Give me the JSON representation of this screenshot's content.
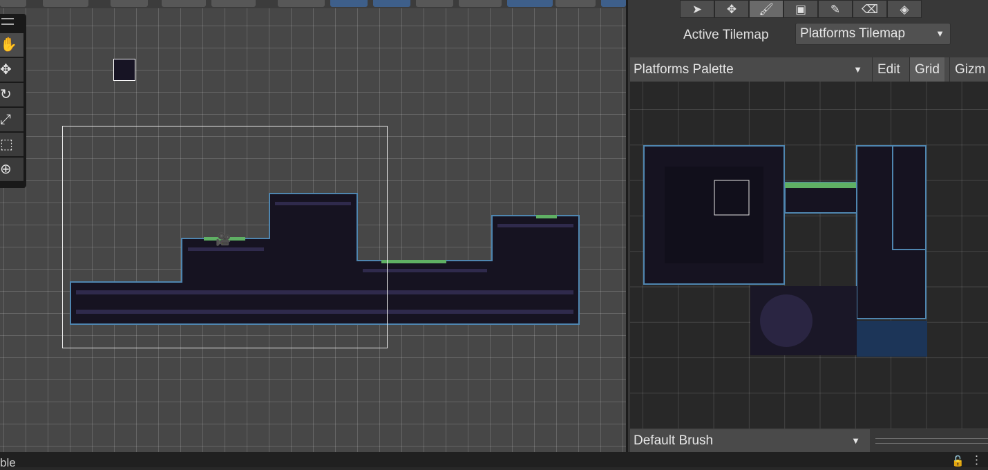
{
  "palette_tools": [
    {
      "name": "select-tool",
      "icon": "arrow-cursor-icon",
      "glyph": "➤"
    },
    {
      "name": "move-tool",
      "icon": "move-arrows-icon",
      "glyph": "✥"
    },
    {
      "name": "paint-tool",
      "icon": "paintbrush-icon",
      "glyph": "🖌"
    },
    {
      "name": "box-fill-tool",
      "icon": "box-fill-icon",
      "glyph": "▣"
    },
    {
      "name": "picker-tool",
      "icon": "eyedropper-icon",
      "glyph": "✎"
    },
    {
      "name": "eraser-tool",
      "icon": "eraser-icon",
      "glyph": "⌫"
    },
    {
      "name": "fill-tool",
      "icon": "paint-bucket-icon",
      "glyph": "◈"
    }
  ],
  "active_tilemap": {
    "label": "Active Tilemap",
    "value": "Platforms Tilemap"
  },
  "palette": {
    "value": "Platforms Palette",
    "edit_label": "Edit",
    "grid_label": "Grid",
    "gizmos_label": "Gizm"
  },
  "brush": {
    "value": "Default Brush"
  },
  "status": {
    "text": "ble"
  },
  "scene_tools": [
    {
      "icon": "hand-icon",
      "glyph": "✋"
    },
    {
      "icon": "move-icon",
      "glyph": "✥"
    },
    {
      "icon": "rotate-icon",
      "glyph": "↻"
    },
    {
      "icon": "scale-icon",
      "glyph": "⤢"
    },
    {
      "icon": "rect-icon",
      "glyph": "⬚"
    },
    {
      "icon": "transform-icon",
      "glyph": "⊕"
    }
  ],
  "colors": {
    "tile_dark": "#161321",
    "tile_edge": "#4f86b0",
    "grass": "#5fb064",
    "water": "#1c3558"
  }
}
